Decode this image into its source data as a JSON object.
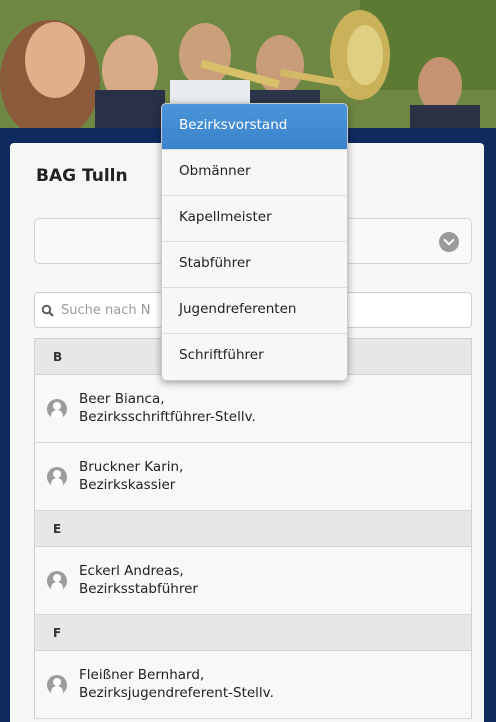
{
  "banner": {
    "image": "brass-band-photo"
  },
  "page": {
    "title": "BAG Tulln"
  },
  "select": {
    "value": "",
    "icon": "chevron-down-icon"
  },
  "search": {
    "placeholder": "Suche nach N"
  },
  "list": {
    "groups": [
      {
        "letter": "B",
        "items": [
          {
            "name": "Beer Bianca,",
            "role": "Bezirksschriftführer-Stellv."
          },
          {
            "name": "Bruckner Karin,",
            "role": "Bezirkskassier"
          }
        ]
      },
      {
        "letter": "E",
        "items": [
          {
            "name": "Eckerl Andreas,",
            "role": "Bezirksstabführer"
          }
        ]
      },
      {
        "letter": "F",
        "items": [
          {
            "name": "Fleißner Bernhard,",
            "role": "Bezirksjugendreferent-Stellv."
          }
        ]
      }
    ]
  },
  "menu": {
    "items": [
      "Bezirksvorstand",
      "Obmänner",
      "Kapellmeister",
      "Stabführer",
      "Jugendreferenten",
      "Schriftführer"
    ],
    "selected_index": 0,
    "accent": "#3e88d1"
  }
}
